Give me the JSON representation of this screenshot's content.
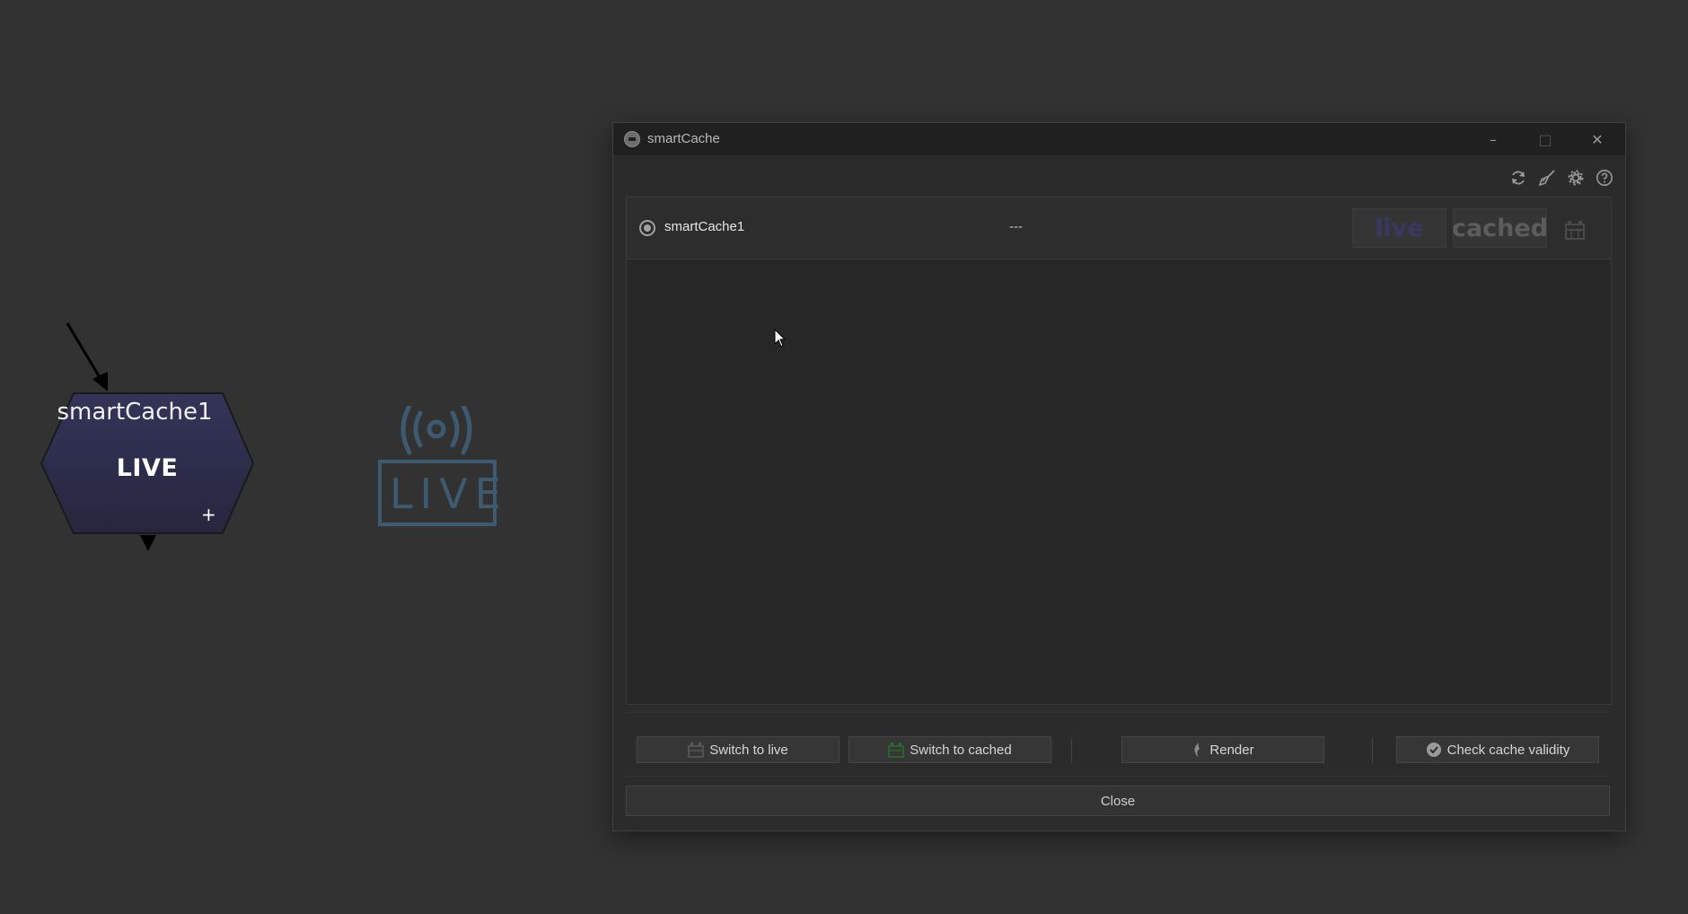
{
  "node": {
    "title": "smartCache1",
    "state": "LIVE",
    "plus": "+"
  },
  "badge": {
    "text": "LIVE"
  },
  "window": {
    "title": "smartCache",
    "minimize": "–",
    "maximize": "□",
    "close": "✕"
  },
  "toolbar": {
    "icons": [
      "refresh-icon",
      "broom-icon",
      "gear-icon",
      "help-icon"
    ]
  },
  "row": {
    "name": "smartCache1",
    "status": "---",
    "live_label": "live",
    "cached_label": "cached"
  },
  "actions": {
    "switch_live": "Switch to live",
    "switch_cached": "Switch to cached",
    "render": "Render",
    "check": "Check cache validity"
  },
  "close_label": "Close",
  "colors": {
    "node_fill": "#2e2e52",
    "badge": "#3e5a70",
    "live_text": "#383864"
  }
}
